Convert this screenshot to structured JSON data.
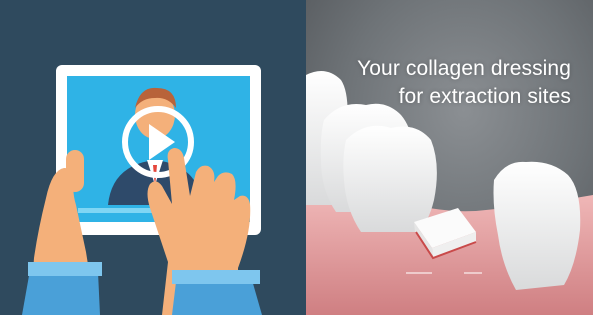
{
  "left_tile": {
    "illustration": "hands-touching-tablet-video",
    "icons": [
      "tablet-icon",
      "play-icon",
      "presenter-avatar",
      "hand-icon"
    ],
    "colors": {
      "background": "#2f4a5e",
      "screen": "#2fb3e6",
      "tablet_frame": "#ffffff",
      "skin": "#f4b07a",
      "sleeve": "#4aa0d8"
    }
  },
  "right_tile": {
    "caption_line1": "Your collagen dressing",
    "caption_line2": "for extraction sites",
    "illustration": "teeth-with-collagen-dressing",
    "colors": {
      "background": "#6e7377",
      "gum": "#e5a6a6",
      "tooth": "#f3f3f3",
      "dressing": "#f7f7f7",
      "text": "#ffffff"
    }
  }
}
